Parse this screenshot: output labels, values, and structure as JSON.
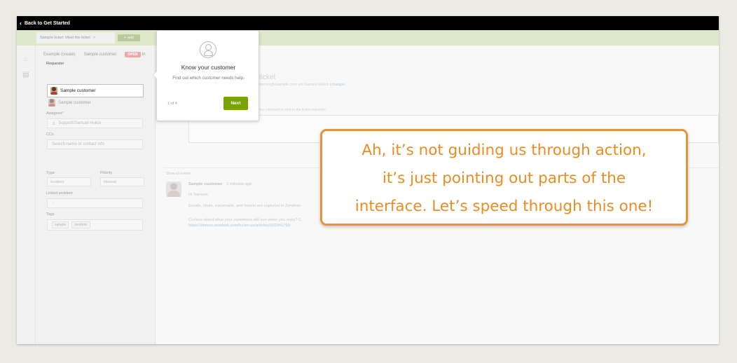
{
  "topbar": {
    "back_label": "Back to Get Started"
  },
  "tabs": {
    "ticket_tab_label": "Sample ticket: Meet the ticket",
    "add_label": "+ add"
  },
  "breadcrumb": {
    "items": [
      "Example (create)",
      "Sample customer"
    ],
    "status_badge": "OPEN",
    "trailing": "In"
  },
  "left_panel": {
    "requester_label": "Requester",
    "requester_value": "Sample customer",
    "suggestion_value": "Sample customer",
    "assignee_label": "Assignee*",
    "assignee_value": "Support/Samuel Hulick",
    "ccs_label": "CCs",
    "ccs_placeholder": "Search name or contact info",
    "type_label": "Type",
    "type_value": "Incident",
    "priority_label": "Priority",
    "priority_value": "Normal",
    "linked_problem_label": "Linked problem",
    "linked_problem_value": "-",
    "tags_label": "Tags",
    "tags": [
      "sample",
      "zendesk"
    ]
  },
  "main": {
    "ticket_title": "ticket",
    "ticket_sub": "m customer@example.com via Samuel Hulick",
    "change_link": "(change)",
    "reply_hint": "your comment is sent to the ticket requester",
    "show_events": "Show all events",
    "comment_author": "Sample customer",
    "comment_time": "3 minutes ago",
    "comment_lines": [
      "Hi Samuel,",
      "Emails, chats, voicemails, and tweets are captured in Zendesk",
      "Curious about what your customers will see when you reply? C"
    ],
    "comment_link": "https://demos.zendesk.com/hc/en-us/articles/202341799"
  },
  "popover": {
    "title": "Know your customer",
    "body": "Find out which customer needs help.",
    "step": "1 of 4",
    "next_label": "Next"
  },
  "callout": {
    "lines": [
      "Ah, it’s not guiding us through action,",
      "it’s just pointing out parts of the",
      "interface. Let’s speed through this one!"
    ]
  },
  "colors": {
    "accent_green": "#78a300",
    "callout_orange": "#e6933a",
    "status_red": "#f0a9a9",
    "tabbar_green": "#dde8c8"
  }
}
